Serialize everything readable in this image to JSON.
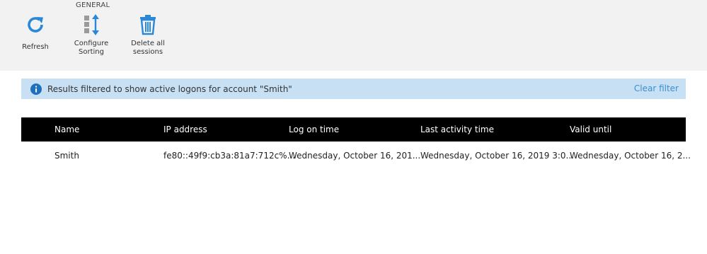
{
  "ribbon": {
    "group_label": "GENERAL",
    "buttons": {
      "refresh": "Refresh",
      "configure_sorting_line1": "Configure",
      "configure_sorting_line2": "Sorting",
      "delete_line1": "Delete all",
      "delete_line2": "sessions"
    }
  },
  "info_bar": {
    "message": "Results filtered to show active logons for account \"Smith\"",
    "clear_filter": "Clear filter"
  },
  "table": {
    "headers": [
      "Name",
      "IP address",
      "Log on time",
      "Last activity time",
      "Valid until"
    ],
    "rows": [
      [
        "Smith",
        "fe80::49f9:cb3a:81a7:712c%...",
        "Wednesday, October 16, 201...",
        "Wednesday, October 16, 2019 3:0...",
        "Wednesday, October 16, 2..."
      ]
    ]
  },
  "icons": {
    "refresh": "refresh-icon",
    "sorting": "sort-icon",
    "delete": "trash-icon",
    "info": "info-icon"
  },
  "colors": {
    "accent": "#2b88d8",
    "info_bar_bg": "#c7e0f4",
    "header_bg": "#000000",
    "link": "#3a8fd0"
  }
}
